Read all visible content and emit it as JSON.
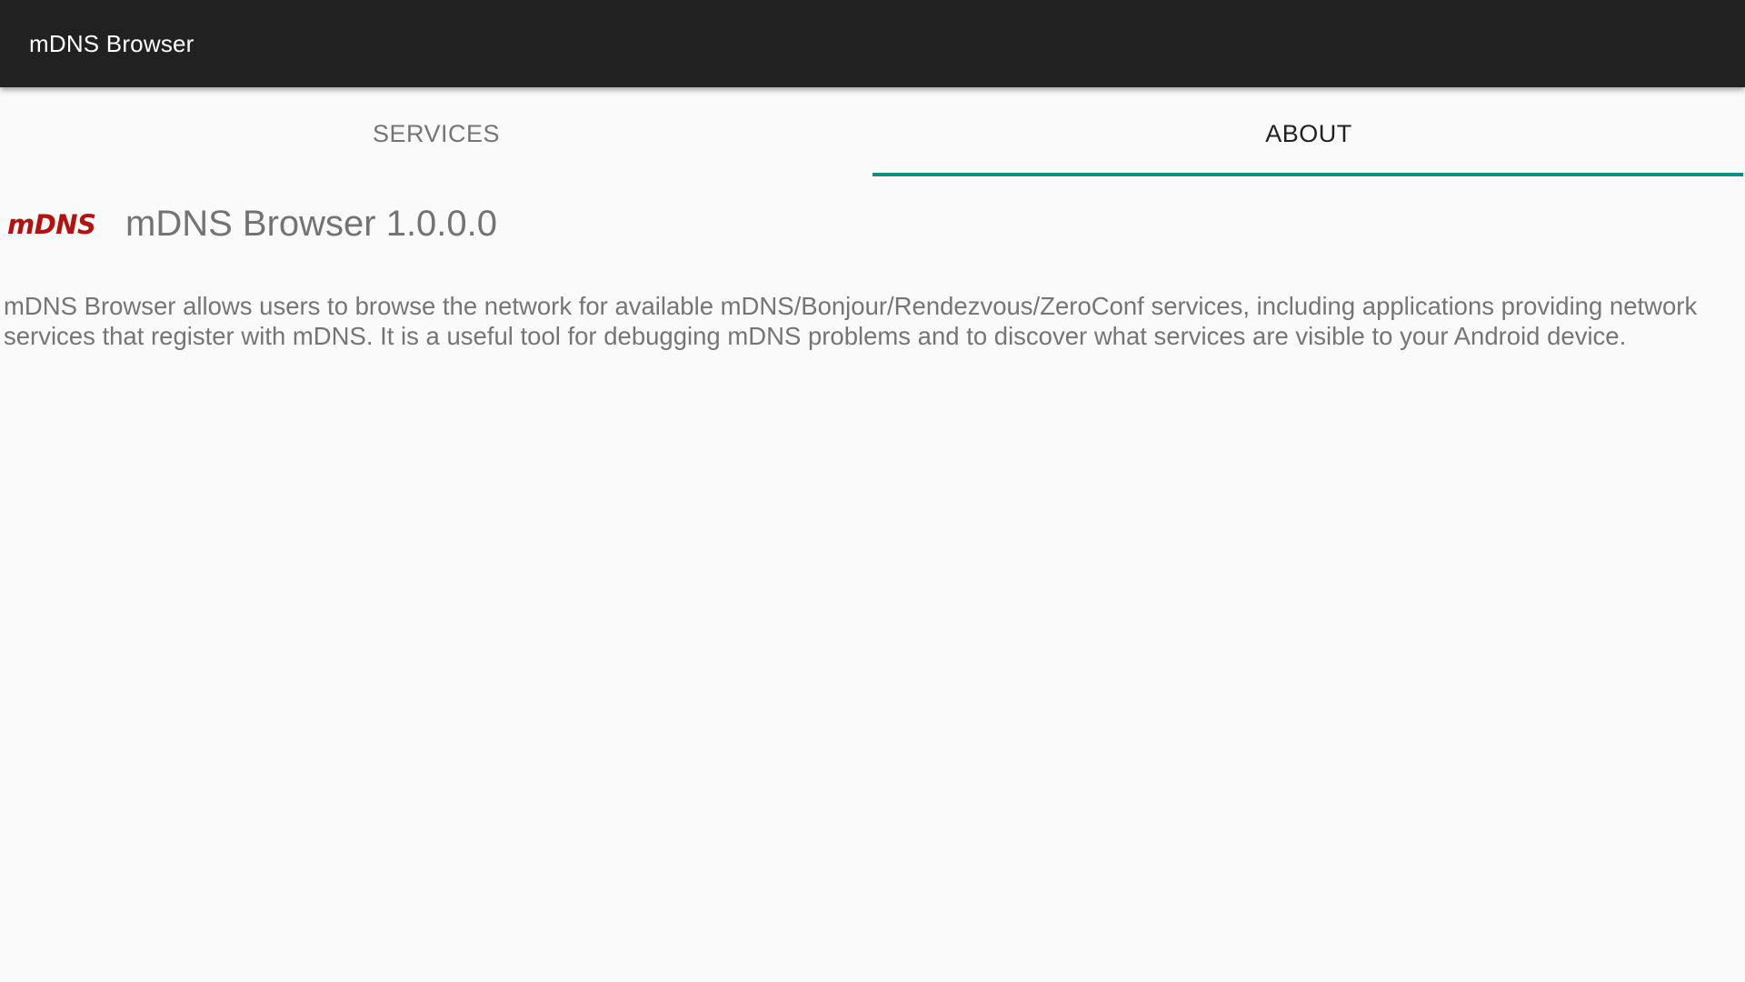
{
  "app_bar": {
    "title": "mDNS Browser"
  },
  "tabs": [
    {
      "label": "SERVICES",
      "active": false
    },
    {
      "label": "ABOUT",
      "active": true
    }
  ],
  "about": {
    "logo_text": "mDNS",
    "title": "mDNS Browser 1.0.0.0",
    "description": "mDNS Browser allows users to browse the network for available mDNS/Bonjour/Rendezvous/ZeroConf services, including applications providing network services that register with mDNS. It is a useful tool for debugging mDNS problems and to discover what services are visible to your Android device."
  },
  "colors": {
    "app_bar_bg": "#212121",
    "tab_indicator": "#0d8f88",
    "logo": "#b3120f",
    "background": "#fafafa"
  }
}
